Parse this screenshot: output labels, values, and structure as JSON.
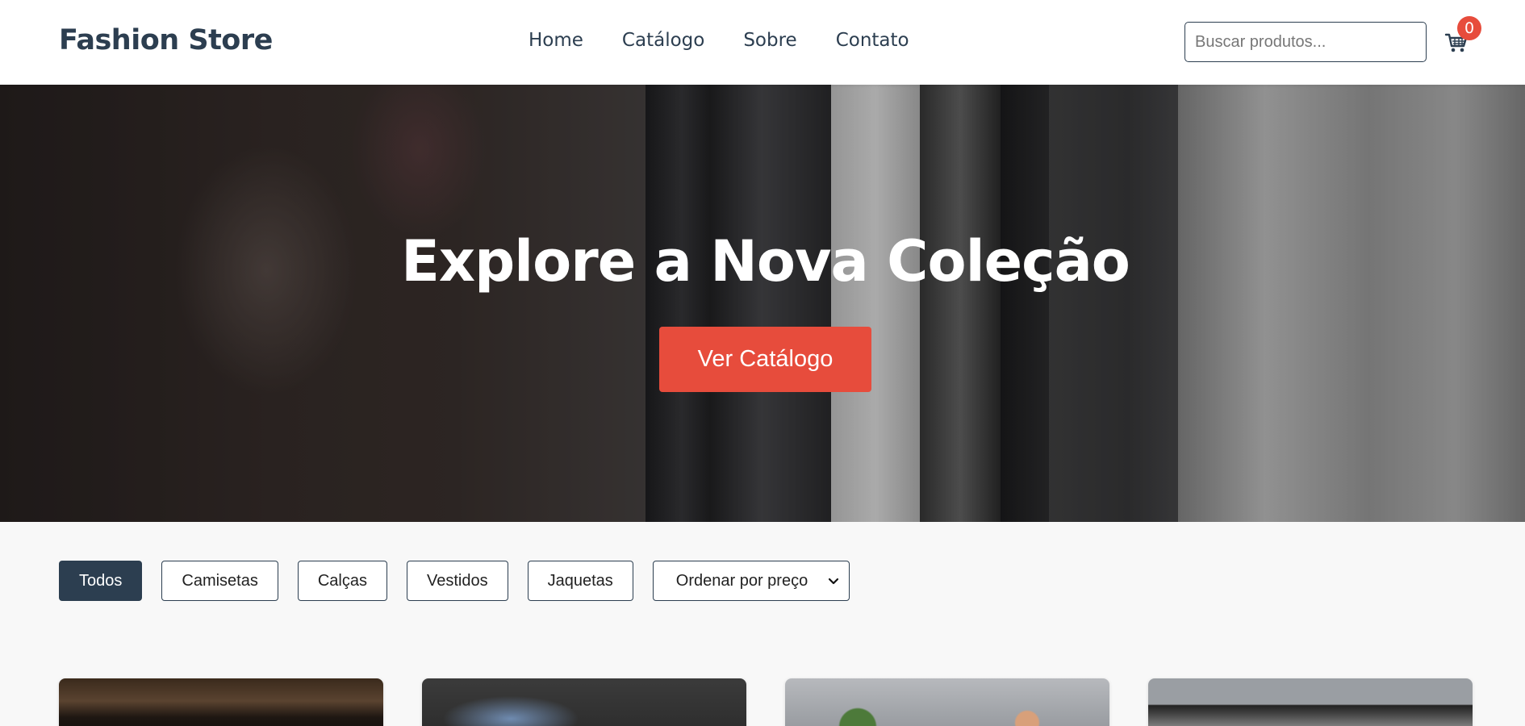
{
  "header": {
    "logo": "Fashion Store",
    "nav": [
      "Home",
      "Catálogo",
      "Sobre",
      "Contato"
    ],
    "search_placeholder": "Buscar produtos...",
    "cart_count": "0",
    "cart_icon": "cart-icon"
  },
  "hero": {
    "title": "Explore a Nova Coleção",
    "button_label": "Ver Catálogo"
  },
  "filters": {
    "buttons": [
      "Todos",
      "Camisetas",
      "Calças",
      "Vestidos",
      "Jaquetas"
    ],
    "active": "Todos",
    "sort_selected": "Ordenar por preço"
  },
  "colors": {
    "primary": "#2c3e50",
    "accent": "#e74c3c",
    "background": "#f8f8f8"
  }
}
